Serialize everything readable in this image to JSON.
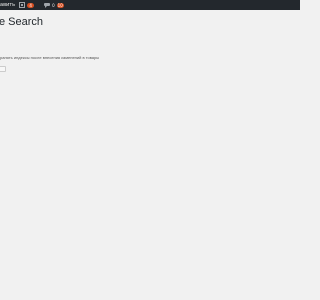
{
  "adminbar": {
    "left_text": "авить",
    "updates": {
      "icon": "updates-icon",
      "count": "4"
    },
    "comments": {
      "icon": "comment-icon",
      "count": "0",
      "badge": "10"
    }
  },
  "page": {
    "title": "e Search",
    "description": "ранять индексы после внесения изменений в товары",
    "button_label": ""
  },
  "colors": {
    "adminbar_bg": "#23282d",
    "page_bg": "#f1f1f1",
    "badge_bg": "#d54e21",
    "title_text": "#23282d"
  }
}
